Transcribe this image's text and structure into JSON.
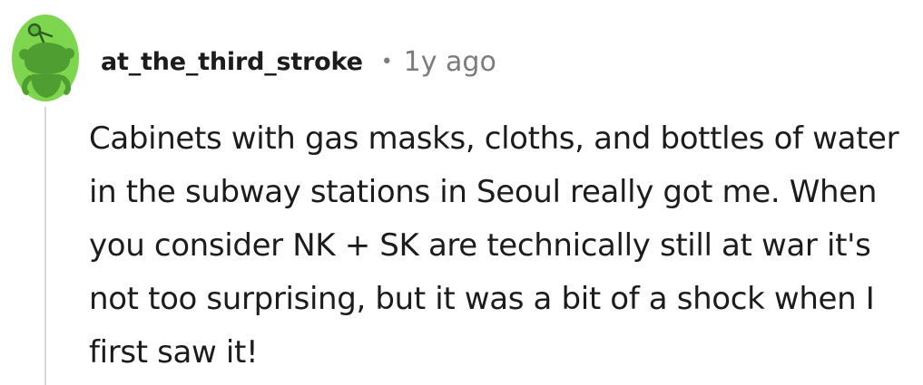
{
  "comment": {
    "avatar_icon": "snoo-avatar-icon",
    "avatar_color": "#7ed64f",
    "username": "at_the_third_stroke",
    "separator": "•",
    "timestamp": "1y ago",
    "body": "Cabinets with gas masks, cloths, and bottles of water in the subway stations in Seoul really got me. When you consider NK + SK are technically still at war it's not too surprising, but it was a bit of a shock when I first saw it!"
  }
}
